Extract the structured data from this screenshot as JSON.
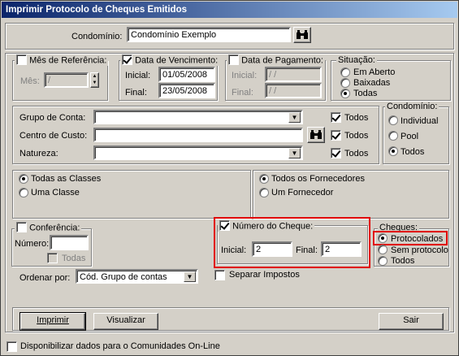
{
  "window": {
    "title": "Imprimir Protocolo de Cheques Emitidos"
  },
  "condominio": {
    "label": "Condomínio:",
    "value": "Condomínio Exemplo"
  },
  "mes_referencia": {
    "label": "Mês de Referência:",
    "mes_label": "Mês:",
    "mes_value": "/",
    "checked": false
  },
  "data_vencimento": {
    "label": "Data de Vencimento:",
    "checked": true,
    "inicial_label": "Inicial:",
    "inicial_value": "01/05/2008",
    "final_label": "Final:",
    "final_value": "23/05/2008"
  },
  "data_pagamento": {
    "label": "Data de Pagamento:",
    "checked": false,
    "inicial_label": "Inicial:",
    "inicial_value": "/  /",
    "final_label": "Final:",
    "final_value": "/  /"
  },
  "situacao": {
    "label": "Situação:",
    "options": [
      "Em Aberto",
      "Baixadas",
      "Todas"
    ],
    "selected": "Todas"
  },
  "filtros": {
    "grupo_label": "Grupo de Conta:",
    "centro_label": "Centro de Custo:",
    "natureza_label": "Natureza:",
    "todos_label": "Todos"
  },
  "condominio_tipo": {
    "label": "Condomínio:",
    "options": [
      "Individual",
      "Pool",
      "Todos"
    ],
    "selected": "Todos"
  },
  "classes": {
    "options": [
      "Todas as Classes",
      "Uma Classe"
    ],
    "selected": "Todas as Classes"
  },
  "fornecedores": {
    "options": [
      "Todos os Fornecedores",
      "Um Fornecedor"
    ],
    "selected": "Todos os Fornecedores"
  },
  "conferencia": {
    "label": "Conferência:",
    "numero_label": "Número:",
    "todas_label": "Todas"
  },
  "numero_cheque": {
    "label": "Número do Cheque:",
    "checked": true,
    "inicial_label": "Inicial:",
    "inicial_value": "2",
    "final_label": "Final:",
    "final_value": "2"
  },
  "cheques": {
    "label": "Cheques:",
    "options": [
      "Protocolados",
      "Sem protocolo",
      "Todos"
    ],
    "selected": "Protocolados"
  },
  "ordenar": {
    "label": "Ordenar por:",
    "value": "Cód. Grupo de contas"
  },
  "separar_impostos": {
    "label": "Separar Impostos",
    "checked": false
  },
  "buttons": {
    "imprimir": "Imprimir",
    "visualizar": "Visualizar",
    "sair": "Sair"
  },
  "disponibilizar": {
    "label": "Disponibilizar dados para o Comunidades On-Line",
    "checked": false
  },
  "colors": {
    "titlebar_start": "#0a246a",
    "titlebar_end": "#a6caf0",
    "highlight": "#e00000",
    "face": "#d4d0c8"
  }
}
